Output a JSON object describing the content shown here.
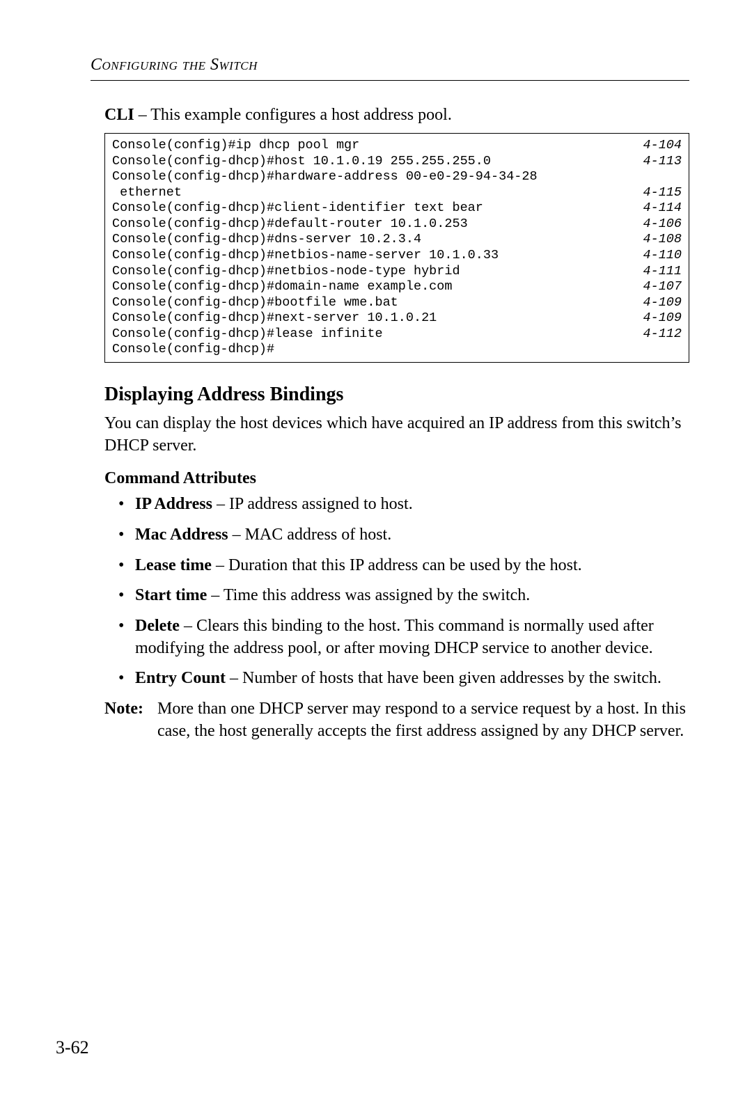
{
  "running_head": "Configuring the Switch",
  "intro_prefix": "CLI",
  "intro_rest": " – This example configures a host address pool.",
  "cli": [
    {
      "cmd": "Console(config)#ip dhcp pool mgr",
      "ref": "4-104"
    },
    {
      "cmd": "Console(config-dhcp)#host 10.1.0.19 255.255.255.0",
      "ref": "4-113"
    },
    {
      "cmd": "Console(config-dhcp)#hardware-address 00-e0-29-94-34-28",
      "ref": ""
    },
    {
      "cmd": " ethernet",
      "ref": "4-115"
    },
    {
      "cmd": "Console(config-dhcp)#client-identifier text bear",
      "ref": "4-114"
    },
    {
      "cmd": "Console(config-dhcp)#default-router 10.1.0.253",
      "ref": "4-106"
    },
    {
      "cmd": "Console(config-dhcp)#dns-server 10.2.3.4",
      "ref": "4-108"
    },
    {
      "cmd": "Console(config-dhcp)#netbios-name-server 10.1.0.33",
      "ref": "4-110"
    },
    {
      "cmd": "Console(config-dhcp)#netbios-node-type hybrid",
      "ref": "4-111"
    },
    {
      "cmd": "Console(config-dhcp)#domain-name example.com",
      "ref": "4-107"
    },
    {
      "cmd": "Console(config-dhcp)#bootfile wme.bat",
      "ref": "4-109"
    },
    {
      "cmd": "Console(config-dhcp)#next-server 10.1.0.21",
      "ref": "4-109"
    },
    {
      "cmd": "Console(config-dhcp)#lease infinite",
      "ref": "4-112"
    },
    {
      "cmd": "Console(config-dhcp)#",
      "ref": ""
    }
  ],
  "section_heading": "Displaying Address Bindings",
  "section_para": "You can display the host devices which have acquired an IP address from this switch’s DHCP server.",
  "subheading": "Command Attributes",
  "attrs": [
    {
      "term": "IP Address",
      "desc": " – IP address assigned to host."
    },
    {
      "term": "Mac Address",
      "desc": " – MAC address of host."
    },
    {
      "term": "Lease time",
      "desc": " – Duration that this IP address can be used by the host."
    },
    {
      "term": "Start time",
      "desc": " – Time this address was assigned by the switch."
    },
    {
      "term": "Delete",
      "desc": " – Clears this binding to the host. This command is normally used after modifying the address pool, or after moving DHCP service to another device."
    },
    {
      "term": "Entry Count",
      "desc": " – Number of hosts that have been given addresses by the switch."
    }
  ],
  "note_label": "Note:",
  "note_body": "More than one DHCP server may respond to a service request by a host. In this case, the host generally accepts the first address assigned by any DHCP server.",
  "page_number": "3-62"
}
